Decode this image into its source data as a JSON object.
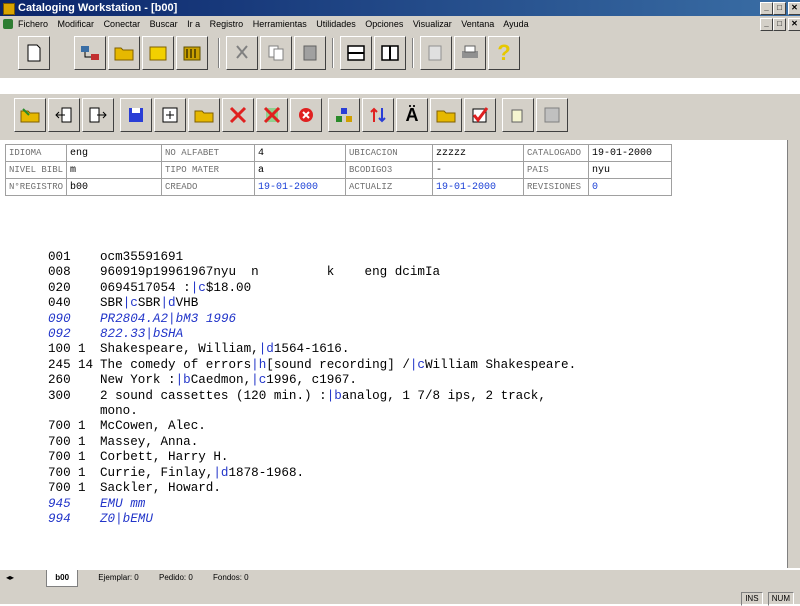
{
  "window": {
    "title": "Cataloging Workstation - [b00]",
    "controls": [
      "_",
      "□",
      "✕"
    ],
    "doc_controls": [
      "_",
      "□",
      "✕"
    ]
  },
  "menu": [
    "Fichero",
    "Modificar",
    "Conectar",
    "Buscar",
    "Ir a",
    "Registro",
    "Herramientas",
    "Utilidades",
    "Opciones",
    "Visualizar",
    "Ventana",
    "Ayuda"
  ],
  "grid": [
    [
      {
        "label": "IDIOMA",
        "value": "eng"
      },
      {
        "label": "NO ALFABET",
        "value": "4"
      },
      {
        "label": "UBICACION",
        "value": "zzzzz"
      },
      {
        "label": "CATALOGADO",
        "value": "19-01-2000"
      }
    ],
    [
      {
        "label": "NIVEL BIBL",
        "value": "m"
      },
      {
        "label": "TIPO MATER",
        "value": "a"
      },
      {
        "label": "BCODIGO3",
        "value": "-"
      },
      {
        "label": "PAIS",
        "value": "nyu"
      }
    ],
    [
      {
        "label": "N°REGISTRO",
        "value": "b00"
      },
      {
        "label": "CREADO",
        "value": "19-01-2000"
      },
      {
        "label": "ACTUALIZ",
        "value": "19-01-2000"
      },
      {
        "label": "REVISIONES",
        "value": "0"
      }
    ]
  ],
  "marc": [
    {
      "tag": "001",
      "ind": "",
      "text": "ocm35591691"
    },
    {
      "tag": "008",
      "ind": "",
      "text": "960919p19961967nyu  n         k    eng dcimIa"
    },
    {
      "tag": "020",
      "ind": "",
      "text": "0694517054 :|c$18.00"
    },
    {
      "tag": "040",
      "ind": "",
      "text": "SBR|cSBR|dVHB"
    },
    {
      "tag": "090",
      "ind": "",
      "text": "PR2804.A2|bM3 1996"
    },
    {
      "tag": "092",
      "ind": "",
      "text": "822.33|bSHA"
    },
    {
      "tag": "100",
      "ind": "1",
      "text": "Shakespeare, William,|d1564-1616."
    },
    {
      "tag": "245",
      "ind": "14",
      "text": "The comedy of errors|h[sound recording] /|cWilliam Shakespeare."
    },
    {
      "tag": "260",
      "ind": "",
      "text": "New York :|bCaedmon,|c1996, c1967."
    },
    {
      "tag": "300",
      "ind": "",
      "text": "2 sound cassettes (120 min.) :|banalog, 1 7/8 ips, 2 track,"
    },
    {
      "tag": "",
      "ind": "",
      "text": "mono."
    },
    {
      "tag": "700",
      "ind": "1",
      "text": "McCowen, Alec."
    },
    {
      "tag": "700",
      "ind": "1",
      "text": "Massey, Anna."
    },
    {
      "tag": "700",
      "ind": "1",
      "text": "Corbett, Harry H."
    },
    {
      "tag": "700",
      "ind": "1",
      "text": "Currie, Finlay,|d1878-1968."
    },
    {
      "tag": "700",
      "ind": "1",
      "text": "Sackler, Howard."
    },
    {
      "tag": "945",
      "ind": "",
      "text": "EMU mm"
    },
    {
      "tag": "994",
      "ind": "",
      "text": "Z0|bEMU"
    }
  ],
  "tabs": [
    {
      "label": "b00"
    },
    {
      "label": "Ejemplar: 0"
    },
    {
      "label": "Pedido: 0"
    },
    {
      "label": "Fondos: 0"
    }
  ],
  "status": [
    "INS",
    "NUM"
  ],
  "colors": {
    "title_bg": "#0a246a",
    "chrome": "#d4d0c8",
    "link_blue": "#2235c9"
  }
}
